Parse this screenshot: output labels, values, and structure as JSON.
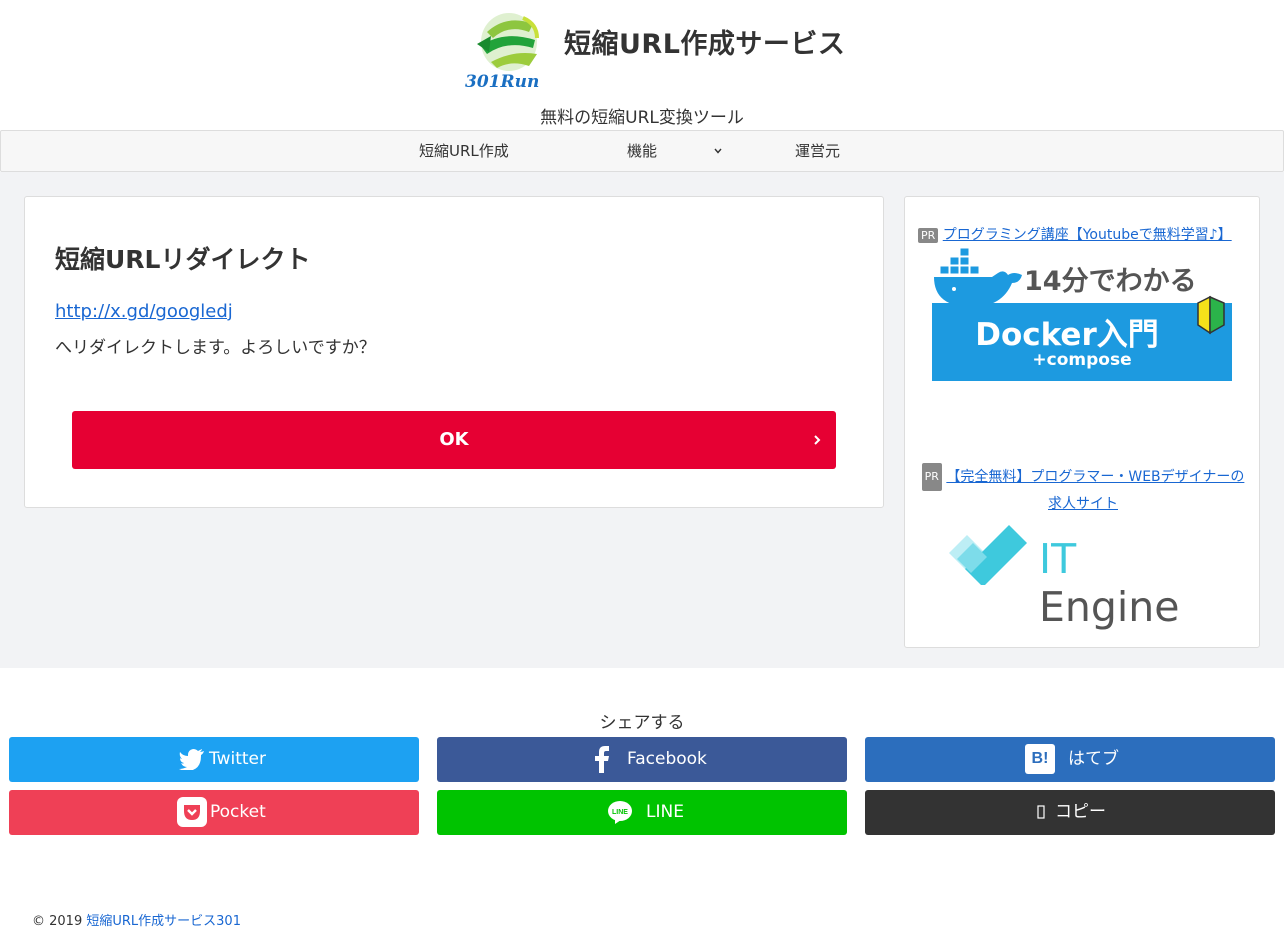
{
  "header": {
    "logo_text": "301Run",
    "site_title": "短縮URL作成サービス",
    "tagline": "無料の短縮URL変換ツール"
  },
  "nav": {
    "items": [
      {
        "label": "短縮URL作成"
      },
      {
        "label": "機能"
      },
      {
        "label": "運営元"
      }
    ]
  },
  "main": {
    "title": "短縮URLリダイレクト",
    "redirect_url": "http://x.gd/googledj",
    "message": "へリダイレクトします。よろしいですか？",
    "ok_label": "OK"
  },
  "sidebar": {
    "ads": [
      {
        "badge": "PR",
        "link_text": "プログラミング講座【Youtubeで無料学習♪】",
        "banner_top": "14分でわかる",
        "banner_title": "Docker入門",
        "banner_sub": "+compose"
      },
      {
        "badge": "PR",
        "link_text": "【完全無料】プログラマー・WEBデザイナーの求人サイト",
        "banner_it": "IT",
        "banner_engine": "Engine"
      }
    ]
  },
  "share": {
    "title": "シェアする",
    "buttons": [
      {
        "label": "Twitter",
        "color": "#1da1f2",
        "icon": "twitter-icon"
      },
      {
        "label": "Facebook",
        "color": "#3b5998",
        "icon": "facebook-icon"
      },
      {
        "label": "はてブ",
        "color": "#2c6ebd",
        "icon": "hatena-icon"
      },
      {
        "label": "Pocket",
        "color": "#ef4056",
        "icon": "pocket-icon"
      },
      {
        "label": "LINE",
        "color": "#00c300",
        "icon": "line-icon"
      },
      {
        "label": "コピー",
        "color": "#333333",
        "icon": "copy-icon"
      }
    ]
  },
  "footer": {
    "copyright": "© 2019",
    "site_link": "短縮URL作成サービス301"
  },
  "colors": {
    "accent": "#e60033",
    "link": "#1967d2",
    "background": "#f2f3f5"
  }
}
